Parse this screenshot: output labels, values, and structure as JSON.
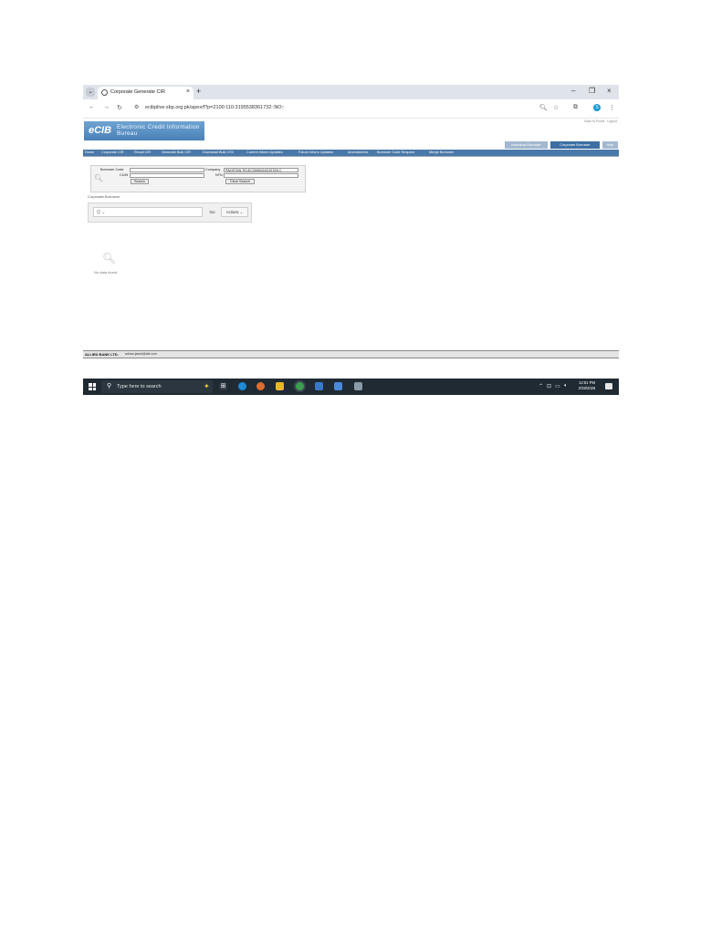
{
  "browser": {
    "tab_dropdown": "⌄",
    "tab_title": "Corporate Generate CIR",
    "tab_close": "×",
    "new_tab": "+",
    "url": "ecibplive.sbp.org.pk/apex/f?p=2100:110:3195538361732::NO::",
    "window_controls": {
      "minimize": "–",
      "restore": "❐",
      "close": "×"
    },
    "profile_letter": "S"
  },
  "page": {
    "top_links": "Back to Portal · Logout",
    "logo_text": "eCIB",
    "logo_subtitle": "Electronic Credit Information Bureau",
    "portal_tabs": [
      "Individual Borrower",
      "Corporate Borrower",
      "Help"
    ],
    "menu": [
      "Home",
      "Corporate CIR",
      "Recall CIR",
      "Generate Bulk CIR",
      "Download Bulk CSV",
      "Current Inform Updates",
      "Future Inform Updates",
      "Amendments",
      "Borrower Code Request",
      "Merge Borrower"
    ],
    "search_form": {
      "borrower_code_label": "Borrower Code",
      "cuin_label": "CUIN",
      "company_label": "Company",
      "company_value": "PAKISTAN TELECOMMUNICATION C",
      "ntn_label": "NTN",
      "search_button": "Search",
      "clear_button": "Clear Search"
    },
    "region_title": "Corporate Borrower",
    "toolbar": {
      "search_placeholder": "Q ⌄",
      "go": "Go",
      "actions": "Actions ⌄"
    },
    "no_data": "No data found",
    "footer": {
      "bank": "ALLIED BANK LTD.",
      "email": "adnan.javed@abl.com"
    }
  },
  "taskbar": {
    "search_placeholder": "Type here to search",
    "time": "12:51 PM",
    "date": "2/28/2025"
  },
  "colors": {
    "menu_bar": "#4a78a8",
    "active_portal_tab": "#3d6fa3",
    "taskbar": "#1f2a33"
  }
}
